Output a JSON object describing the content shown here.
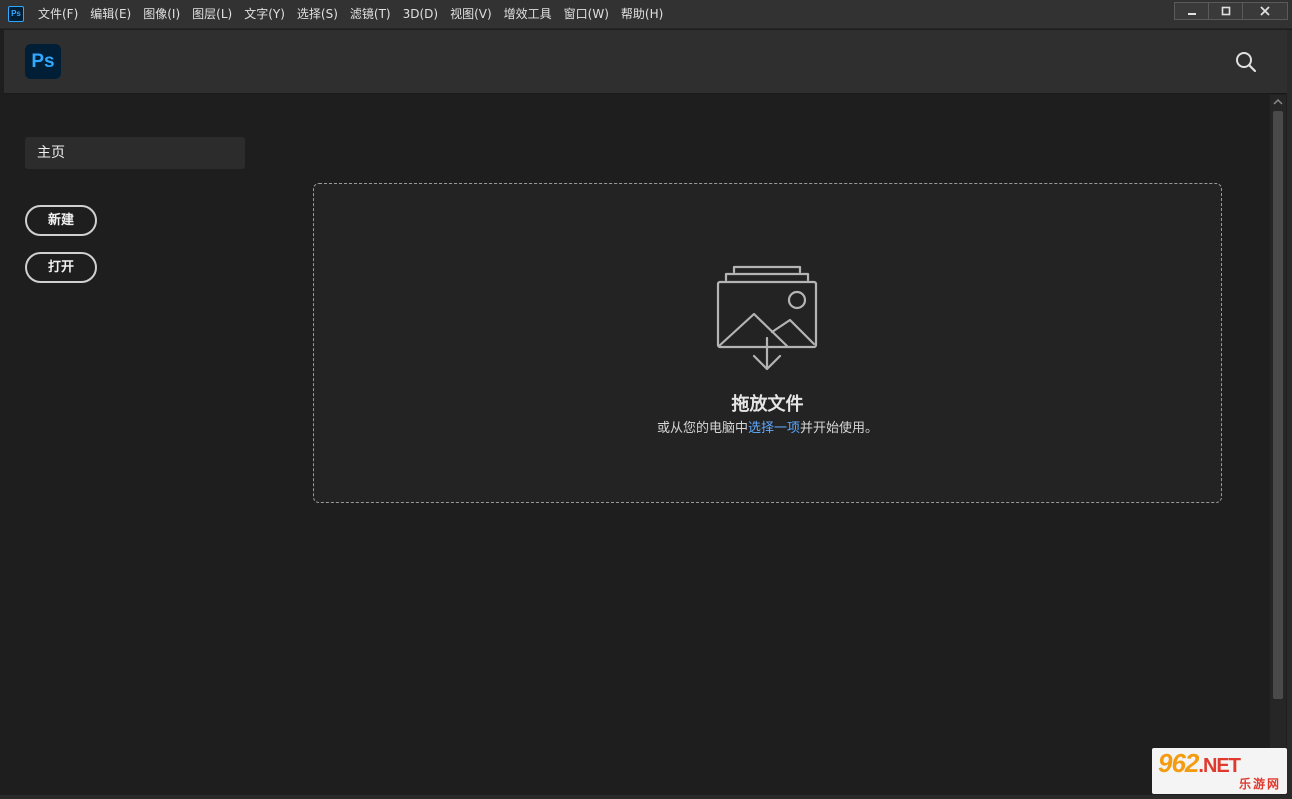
{
  "titlebar": {
    "app_icon_text": "Ps",
    "menu": [
      "文件(F)",
      "编辑(E)",
      "图像(I)",
      "图层(L)",
      "文字(Y)",
      "选择(S)",
      "滤镜(T)",
      "3D(D)",
      "视图(V)",
      "增效工具",
      "窗口(W)",
      "帮助(H)"
    ],
    "window_controls": [
      "minimize-icon",
      "restore-icon",
      "close-icon"
    ]
  },
  "header": {
    "logo_text": "Ps",
    "search_icon": "search-icon"
  },
  "sidebar": {
    "home_label": "主页",
    "new_label": "新建",
    "open_label": "打开"
  },
  "dropzone": {
    "icon": "image-stack-download-icon",
    "title": "拖放文件",
    "sub_before": "或从您的电脑中",
    "sub_link": "选择一项",
    "sub_after": "并开始使用。"
  },
  "watermark": {
    "top": "962",
    "top_suffix": ".NET",
    "bottom": "乐游网"
  },
  "colors": {
    "accent_blue": "#31a8ff",
    "logo_bg": "#001e36",
    "link": "#5ea9ff",
    "background": "#1e1e1e",
    "header": "#2f2f2f"
  }
}
